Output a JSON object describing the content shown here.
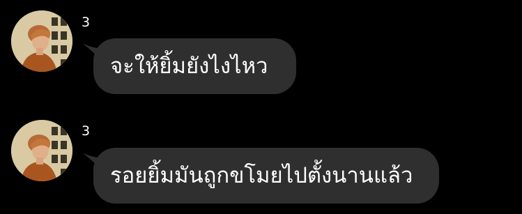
{
  "chat": {
    "messages": [
      {
        "sender_name": "3",
        "avatar_icon": "profile-photo-avatar",
        "text": "จะให้ยิ้มยังไงไหว"
      },
      {
        "sender_name": "3",
        "avatar_icon": "profile-photo-avatar",
        "text": "รอยยิ้มมันถูกขโมยไปตั้งนานแล้ว"
      }
    ]
  },
  "colors": {
    "background": "#000000",
    "bubble": "#2f2f2f",
    "text": "#ffffff"
  }
}
